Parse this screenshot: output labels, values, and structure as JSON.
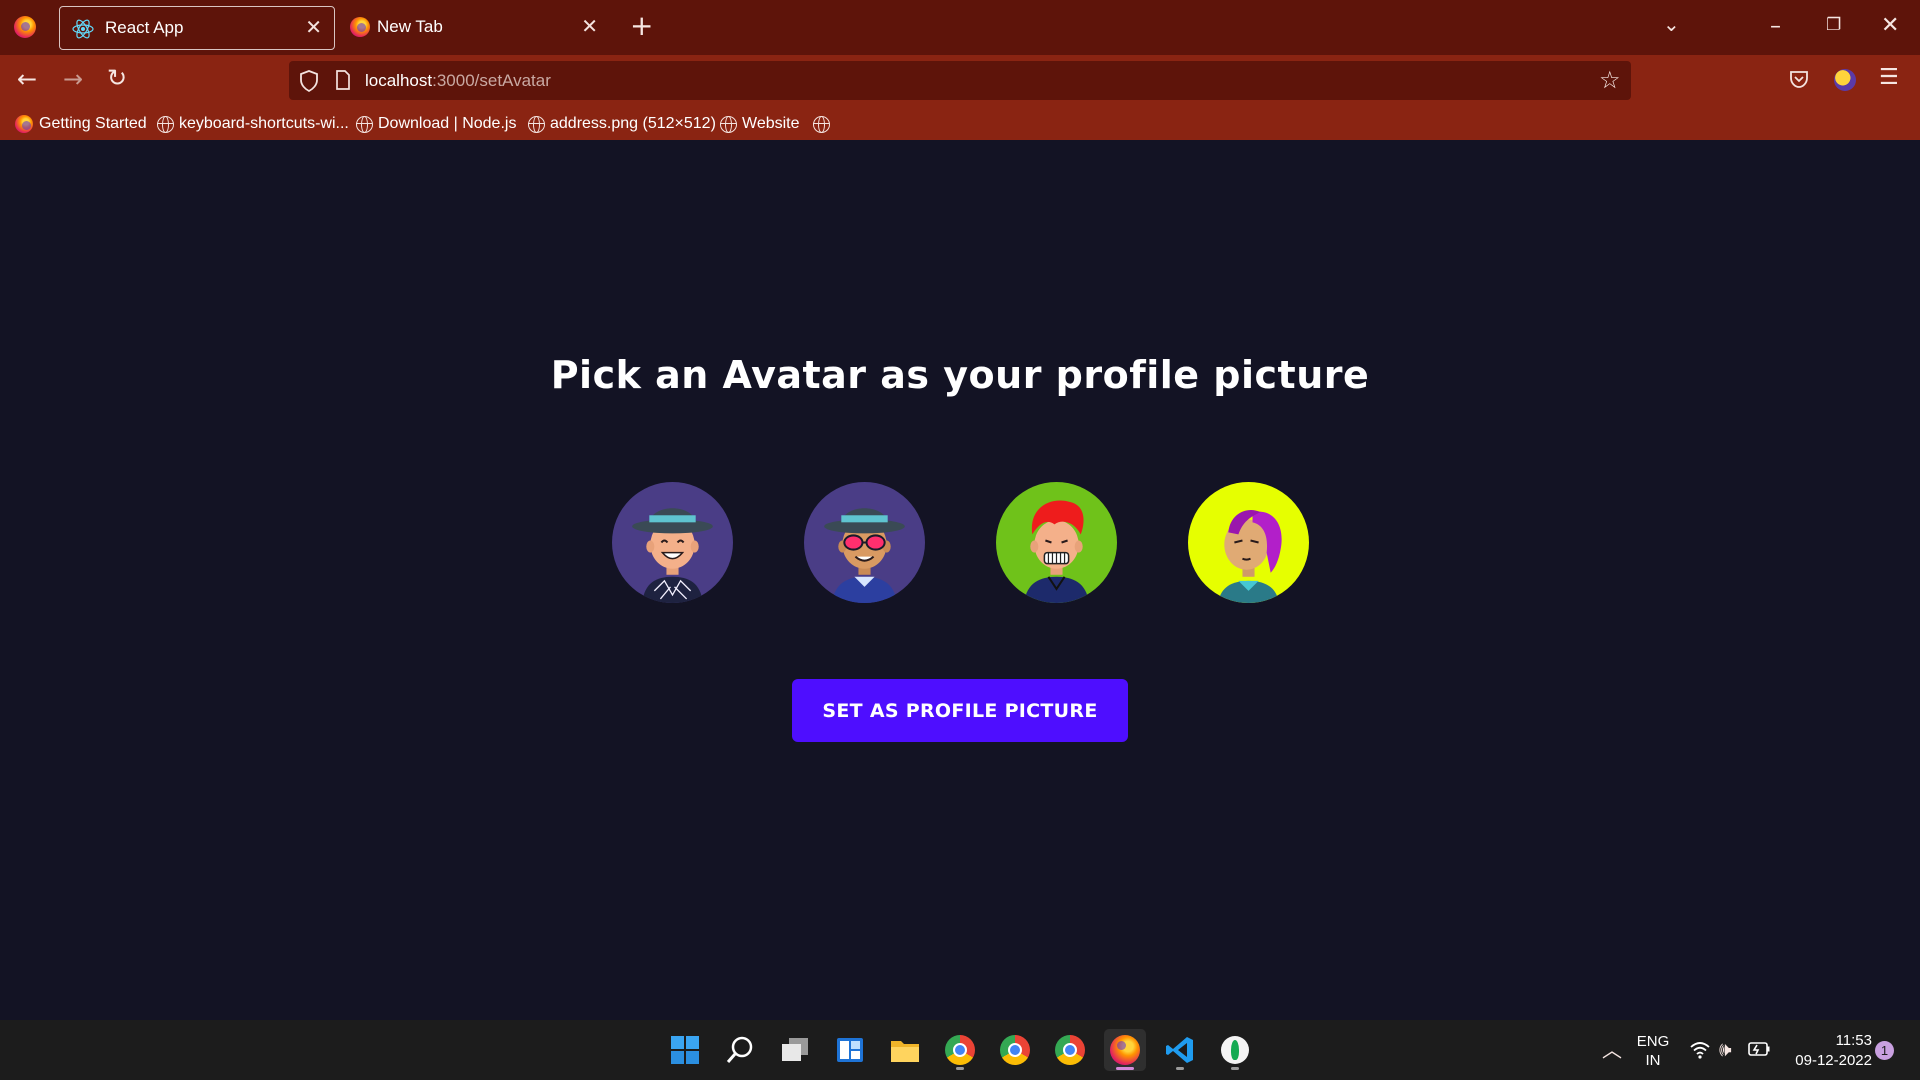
{
  "browser": {
    "tabs": [
      {
        "label": "React App",
        "active": true,
        "icon": "react-icon"
      },
      {
        "label": "New Tab",
        "active": false,
        "icon": "firefox-icon"
      }
    ],
    "url": {
      "host": "localhost",
      "path": ":3000/setAvatar"
    },
    "bookmarks": [
      {
        "label": "Getting Started",
        "icon": "firefox-icon"
      },
      {
        "label": "keyboard-shortcuts-wi...",
        "icon": "globe-icon"
      },
      {
        "label": "Download | Node.js",
        "icon": "globe-icon"
      },
      {
        "label": "address.png (512×512)",
        "icon": "globe-icon"
      },
      {
        "label": "Website",
        "icon": "globe-icon"
      }
    ]
  },
  "page": {
    "title": "Pick an Avatar as your profile picture",
    "avatars": [
      {
        "name": "avatar-1",
        "background": "#4a3d86"
      },
      {
        "name": "avatar-2",
        "background": "#4a3d86"
      },
      {
        "name": "avatar-3",
        "background": "#6fc21a"
      },
      {
        "name": "avatar-4",
        "background": "#e6ff00"
      }
    ],
    "button_label": "SET AS PROFILE PICTURE",
    "colors": {
      "background": "#131324",
      "button": "#4e0eff"
    }
  },
  "taskbar": {
    "apps": [
      "windows-start-icon",
      "search-icon",
      "task-view-icon",
      "widgets-icon",
      "file-explorer-icon",
      "chrome-icon",
      "chrome-icon",
      "chrome-icon",
      "firefox-icon",
      "vscode-icon",
      "mongodb-compass-icon"
    ],
    "language": {
      "line1": "ENG",
      "line2": "IN"
    },
    "time": "11:53",
    "date": "09-12-2022",
    "notification_count": "1"
  }
}
